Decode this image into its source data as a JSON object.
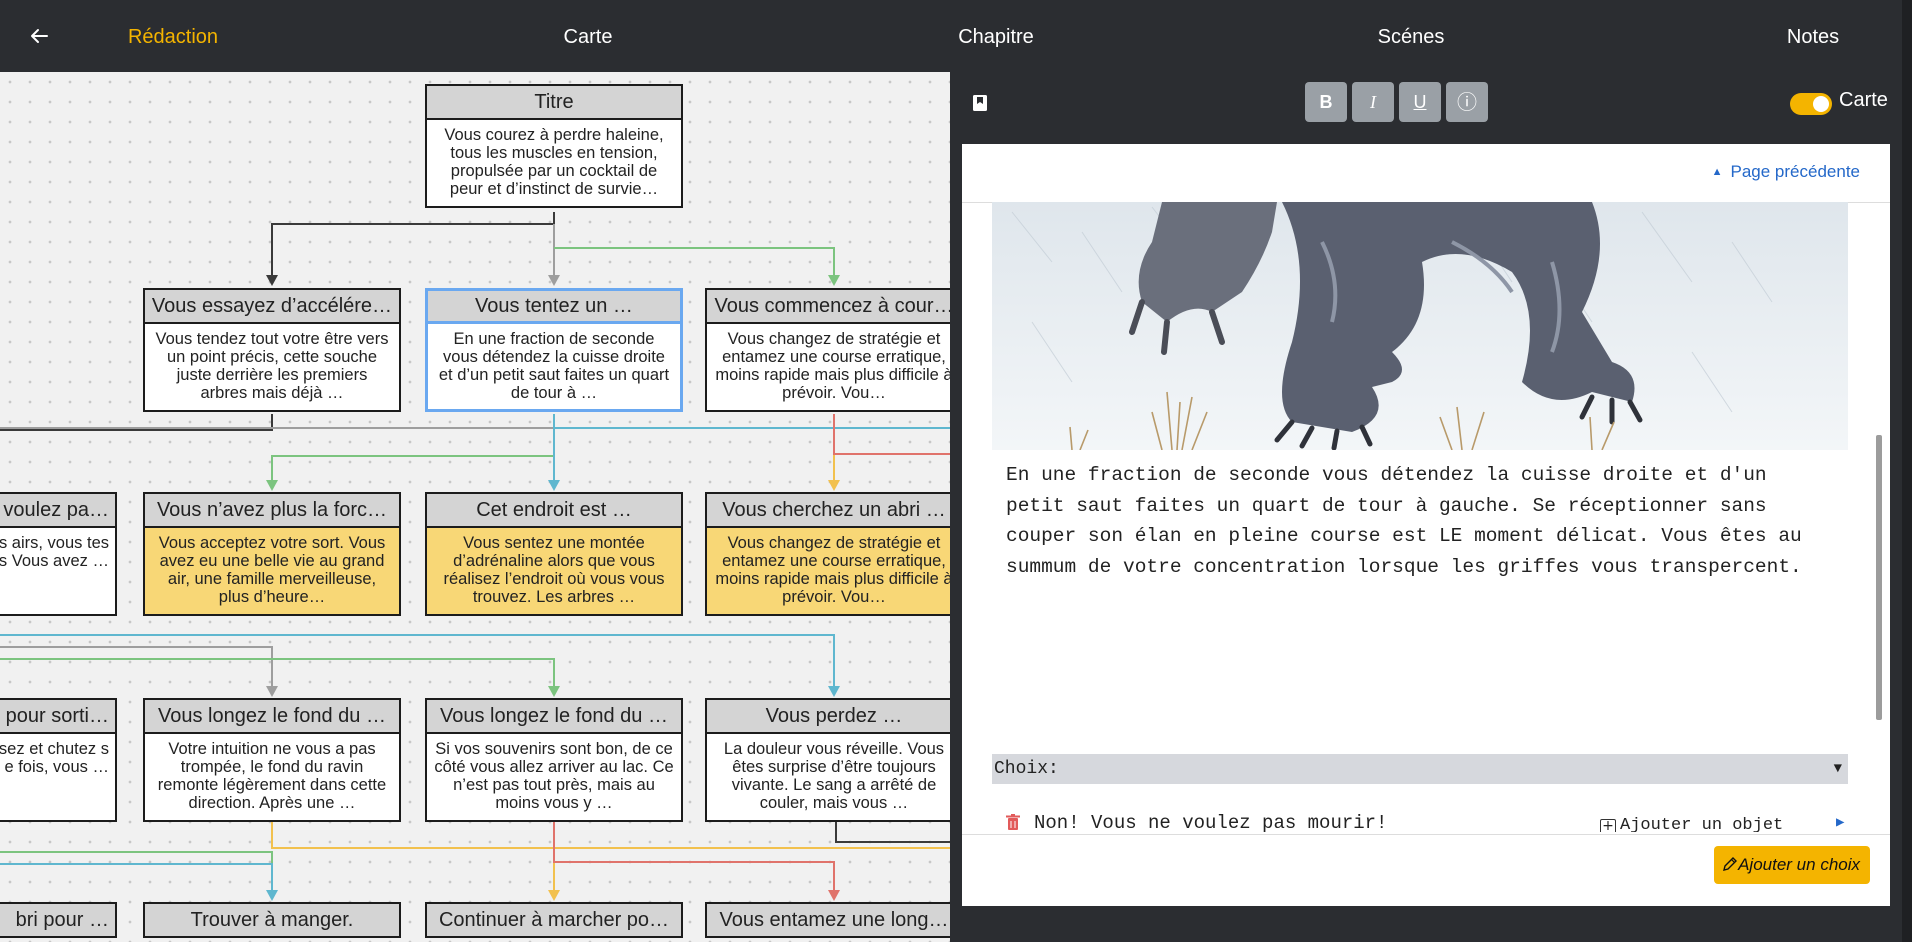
{
  "nav": {
    "back_icon": "arrow-left-icon",
    "items": [
      {
        "label": "Rédaction",
        "active": true
      },
      {
        "label": "Carte"
      },
      {
        "label": "Chapitre"
      },
      {
        "label": "Scénes"
      },
      {
        "label": "Notes"
      }
    ]
  },
  "map": {
    "nodes": [
      {
        "title": "Titre",
        "text": "Vous courez à perdre haleine, tous les muscles en tension, propulsée par un cocktail de peur et d’instinct de survie…"
      },
      {
        "title": "Vous essayez d’accélére…",
        "text": "Vous tendez tout votre être vers un point précis, cette souche juste derrière les premiers arbres mais déjà …"
      },
      {
        "title": "Vous tentez un …",
        "text": "En une fraction de seconde vous détendez la cuisse droite et d’un petit saut faites un quart de tour à …",
        "selected": true
      },
      {
        "title": "Vous commencez à cour…",
        "text": "Vous changez de stratégie et entamez une course erratique, moins rapide mais plus difficile à prévoir. Vou…"
      },
      {
        "title": "voulez pa…",
        "text": "ue vous êtes les airs, vous tes les forces Vous avez …"
      },
      {
        "title": "Vous n’avez plus la forc…",
        "text": "Vous acceptez votre sort. Vous avez eu une belle vie au grand air, une famille merveilleuse, plus d’heure…",
        "highlight": "#f8d776"
      },
      {
        "title": "Cet endroit est …",
        "text": "Vous sentez une montée d’adrénaline alors que vous réalisez l’endroit où vous vous trouvez. Les arbres …",
        "highlight": "#f8d776"
      },
      {
        "title": "Vous cherchez un abri …",
        "text": "Vous changez de stratégie et entamez une course erratique, moins rapide mais plus difficile à prévoir. Vou…",
        "highlight": "#f8d776"
      },
      {
        "title": "pour sorti…",
        "text": "restimé vos ssez et chutez s avant de e fois, vous …"
      },
      {
        "title": "Vous longez le fond du …",
        "text": "Votre intuition ne vous a pas trompée, le fond du ravin remonte légèrement dans cette direction. Après une …"
      },
      {
        "title": "Vous longez le fond du …",
        "text": "Si vos souvenirs sont bon, de ce côté vous allez arriver au lac. Ce n’est pas tout près, mais au moins vous y …"
      },
      {
        "title": "Vous perdez …",
        "text": "La douleur vous réveille. Vous êtes surprise d’être toujours vivante. Le sang a arrêté de couler, mais vous …"
      },
      {
        "title": "bri pour …"
      },
      {
        "title": "Trouver à manger."
      },
      {
        "title": "Continuer à marcher po…"
      },
      {
        "title": "Vous entamez une long…"
      }
    ],
    "edge_colors": {
      "dark": "#3a3a3a",
      "gray": "#9e9e9e",
      "green": "#7cc47f",
      "blue": "#5fb7cf",
      "orange": "#f2c14e",
      "red": "#e0736b"
    }
  },
  "editor": {
    "bookmark_icon": "bookmark-icon",
    "format_buttons": [
      {
        "label": "B",
        "name": "bold-button"
      },
      {
        "label": "I",
        "name": "italic-button"
      },
      {
        "label": "U",
        "name": "underline-button"
      },
      {
        "label": "ⓘ",
        "name": "info-button"
      }
    ],
    "toggle_label": "Carte",
    "toggle_on": true,
    "prev_page": "Page précédente",
    "story_text": "En une fraction de seconde vous détendez la cuisse droite et d'un\npetit saut faites un quart de tour à gauche. Se réceptionner sans\ncouper son élan en pleine course est LE moment délicat. Vous êtes au\nsummum de votre concentration lorsque les griffes vous transpercent.",
    "choices_label": "Choix:",
    "choices": [
      {
        "text": "Non! Vous ne voulez pas mourir!",
        "add_object": "Ajouter un objet"
      }
    ],
    "add_choice": "Ajouter un choix",
    "accent_color": "#f4b400",
    "link_color": "#2468c9"
  }
}
